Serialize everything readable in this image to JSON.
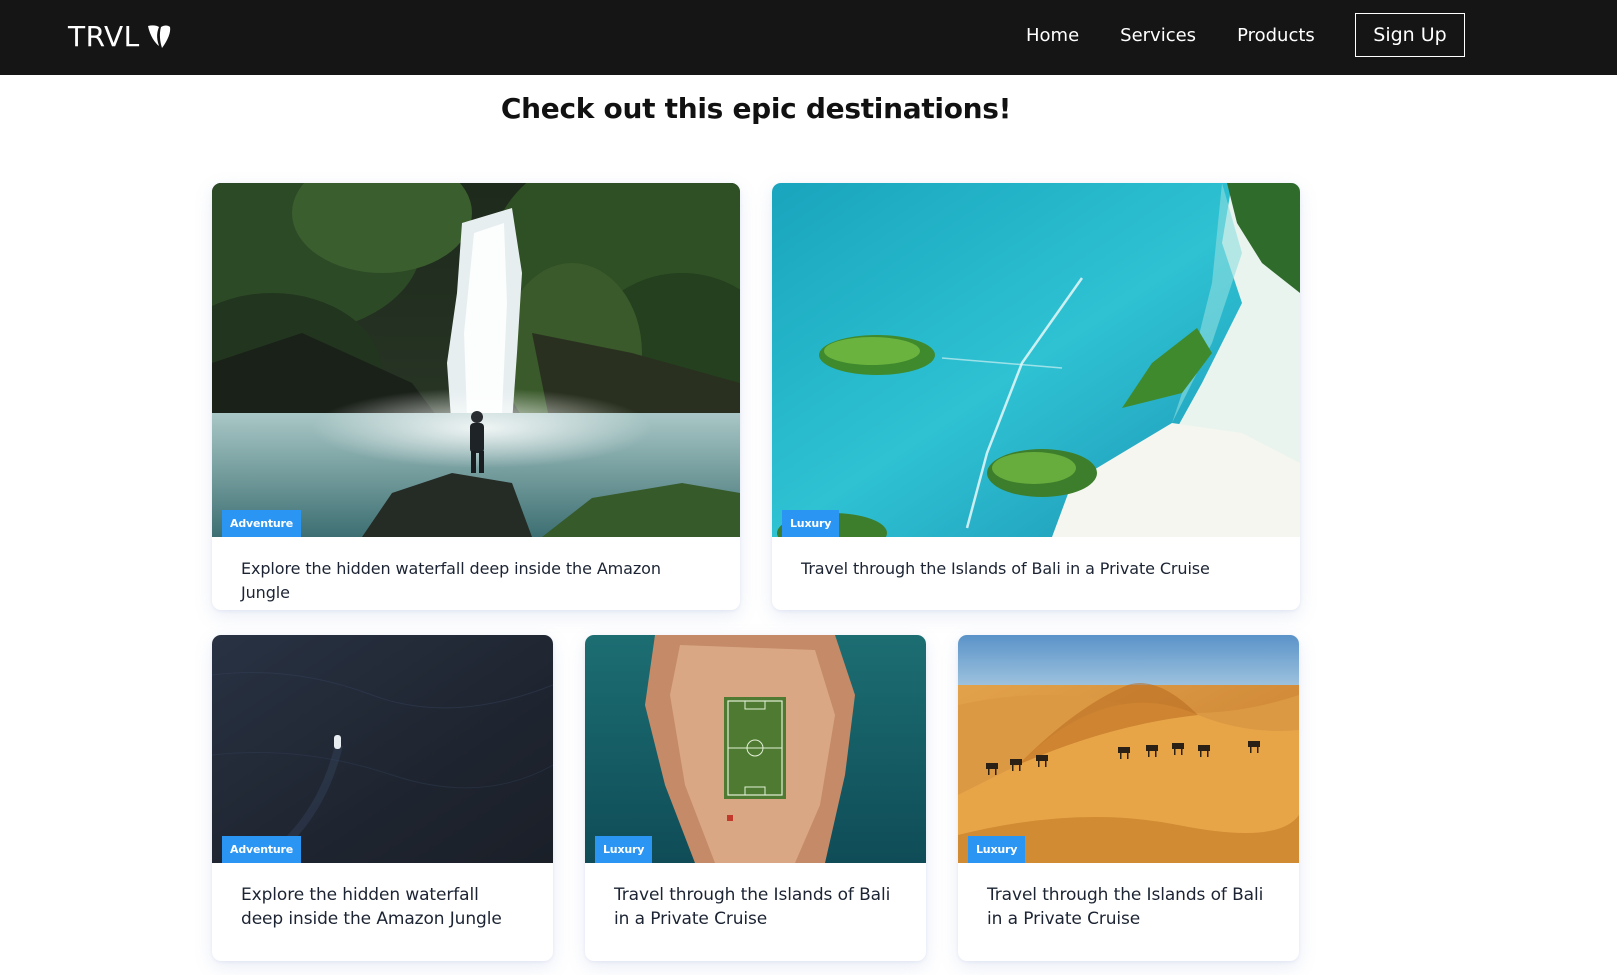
{
  "header": {
    "brand": "TRVL",
    "brand_icon": "typo3-logo-icon",
    "background_color": "#161516",
    "nav": [
      {
        "label": "Home"
      },
      {
        "label": "Services"
      },
      {
        "label": "Products"
      }
    ],
    "signup_label": "Sign Up"
  },
  "main": {
    "title": "Check out this epic destinations!",
    "badge_color": "#2a95f3",
    "cards": [
      {
        "category": "Adventure",
        "title": "Explore the hidden waterfall deep inside the Amazon Jungle",
        "image": "waterfall-jungle-photo"
      },
      {
        "category": "Luxury",
        "title": "Travel through the Islands of Bali in a Private Cruise",
        "image": "turquoise-islands-aerial-photo"
      },
      {
        "category": "Adventure",
        "title": "Explore the hidden waterfall deep inside the Amazon Jungle",
        "image": "dark-ocean-boat-photo"
      },
      {
        "category": "Luxury",
        "title": "Travel through the Islands of Bali in a Private Cruise",
        "image": "island-football-field-photo"
      },
      {
        "category": "Luxury",
        "title": "Travel through the Islands of Bali in a Private Cruise",
        "image": "desert-camel-caravan-photo"
      }
    ]
  }
}
